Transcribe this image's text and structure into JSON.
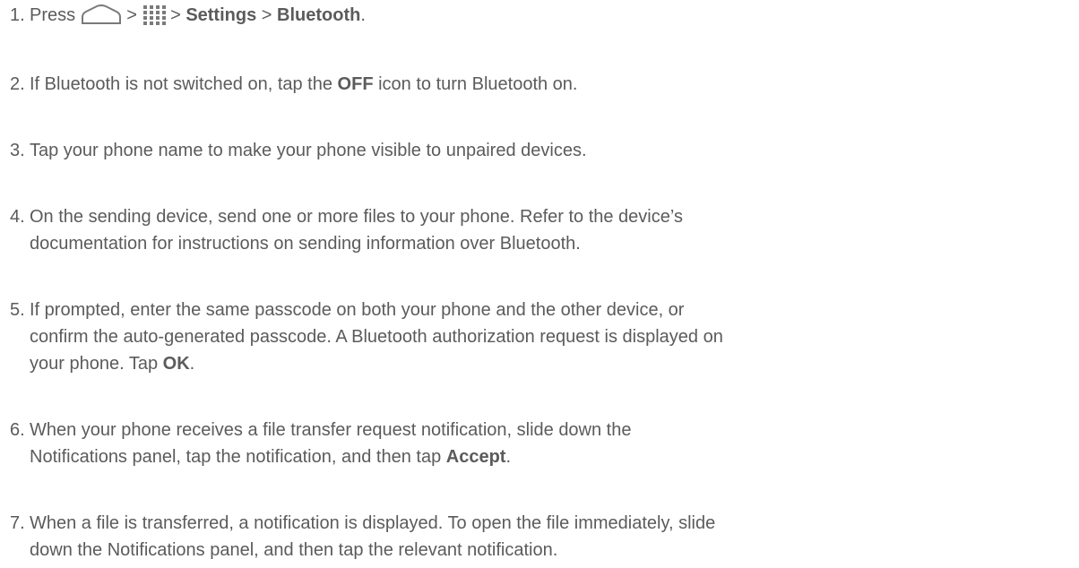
{
  "steps": [
    {
      "number": "1.",
      "press": "Press",
      "sep1": ">",
      "home_icon": "home-icon",
      "apps_icon": "apps-grid-icon",
      "sep2": ">",
      "settings": "Settings",
      "sep3": ">",
      "bluetooth": "Bluetooth",
      "end": "."
    },
    {
      "number": "2.",
      "a": "If Bluetooth is not switched on, tap the ",
      "b": "OFF",
      "c": " icon to turn Bluetooth on."
    },
    {
      "number": "3.",
      "a": "Tap your phone name to make your phone visible to unpaired devices."
    },
    {
      "number": "4.",
      "line1": "On the sending device, send one or more files to your phone. Refer to the device’s",
      "line2": "documentation for instructions on sending information over Bluetooth."
    },
    {
      "number": "5.",
      "line1": "If prompted, enter the same passcode on both your phone and the other device, or",
      "line2": "confirm the auto-generated passcode. A Bluetooth authorization request is displayed on",
      "line3a": "your phone. Tap ",
      "line3b": "OK",
      "line3c": "."
    },
    {
      "number": "6.",
      "line1": "When your phone receives a file transfer request notification, slide down the",
      "line2a": "Notifications panel, tap the notification, and then tap ",
      "line2b": "Accept",
      "line2c": "."
    },
    {
      "number": "7.",
      "line1": "When a file is transferred, a notification is displayed. To open the file immediately, slide",
      "line2": "down the Notifications panel, and then tap the relevant notification."
    }
  ]
}
